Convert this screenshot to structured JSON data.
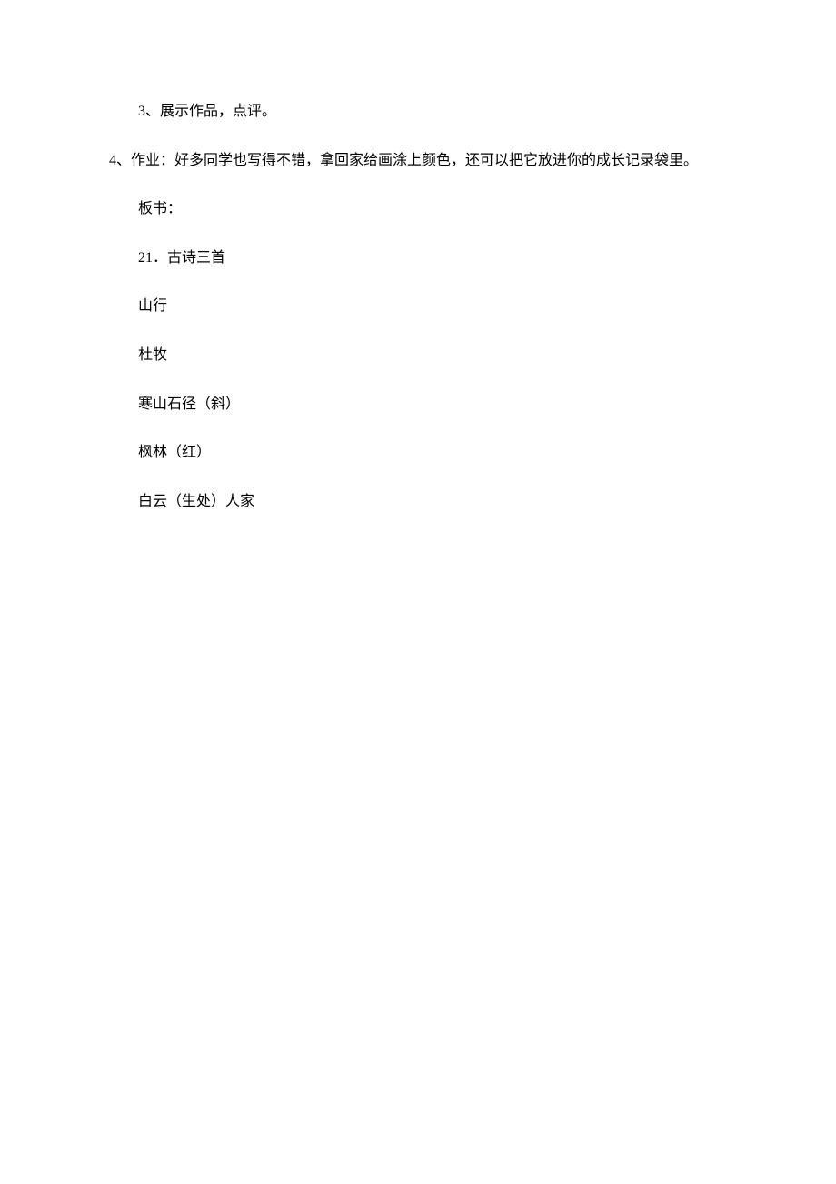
{
  "paragraphs": {
    "p1": "3、展示作品，点评。",
    "p2": "4、作业：好多同学也写得不错，拿回家给画涂上颜色，还可以把它放进你的成长记录袋里。",
    "p3": "板书：",
    "p4": "21．古诗三首",
    "p5": "山行",
    "p6": "杜牧",
    "p7": "寒山石径（斜）",
    "p8": "枫林（红）",
    "p9": "白云（生处）人家"
  }
}
